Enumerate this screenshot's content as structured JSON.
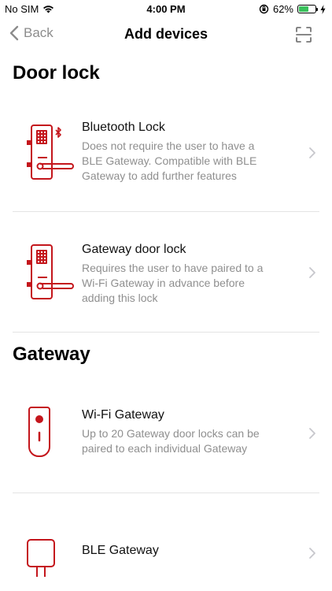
{
  "status_bar": {
    "carrier": "No SIM",
    "time": "4:00 PM",
    "battery_percent": "62%",
    "battery_level": 0.62
  },
  "nav": {
    "back_label": "Back",
    "title": "Add devices"
  },
  "sections": [
    {
      "title": "Door lock",
      "items": [
        {
          "name": "Bluetooth Lock",
          "desc_lines": [
            "Does not require the user to have a",
            "BLE Gateway. Compatible with BLE",
            "Gateway to add further features"
          ]
        },
        {
          "name": "Gateway door lock",
          "desc_lines": [
            "Requires the user to have paired to a",
            "Wi-Fi Gateway in advance before",
            "adding this lock"
          ]
        }
      ]
    },
    {
      "title": "Gateway",
      "items": [
        {
          "name": "Wi-Fi Gateway",
          "desc_lines": [
            "Up to 20 Gateway door locks can be",
            "paired to each individual Gateway"
          ]
        },
        {
          "name": "BLE Gateway",
          "desc_lines": []
        }
      ]
    }
  ],
  "colors": {
    "brand_red": "#c4161c",
    "chevron": "#c7c7cc",
    "desc_gray": "#8f8f8f",
    "divider": "#e4e4e4",
    "battery_green": "#3ac15c"
  }
}
